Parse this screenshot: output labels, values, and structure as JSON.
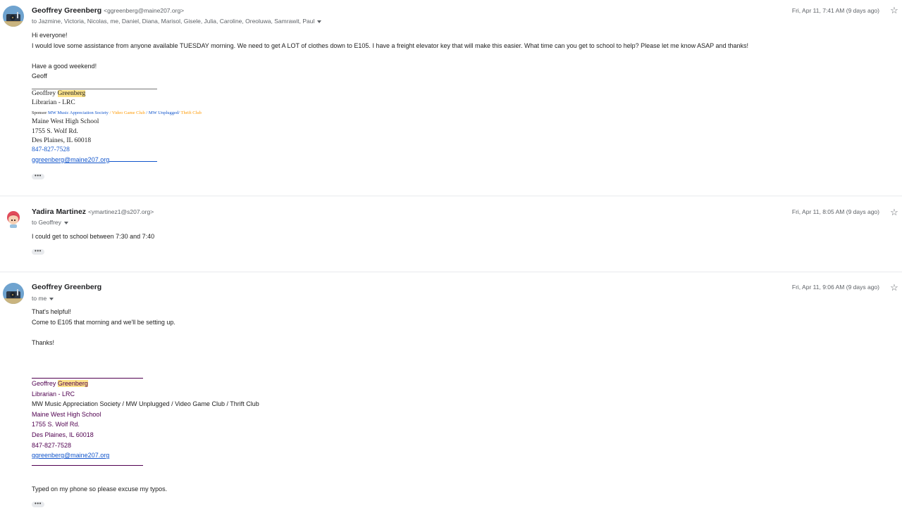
{
  "messages": [
    {
      "sender_name": "Geoffrey Greenberg",
      "sender_email": "<ggreenberg@maine207.org>",
      "recipients": "to Jazmine, Victoria, Nicolas, me, Daniel, Diana, Marisol, Gisele, Julia, Caroline, Oreoluwa, Samrawit, Paul",
      "date": "Fri, Apr 11, 7:41 AM (9 days ago)",
      "body_lines": [
        "Hi everyone!",
        "I would love some assistance from anyone available TUESDAY morning. We need to get A LOT of clothes down to E105. I have a freight elevator key that will make this easier. What time can you get to school to help? Please let me know ASAP and thanks!",
        "",
        "Have a good weekend!",
        "Geoff"
      ],
      "signature": {
        "name_first": "Geoffrey",
        "name_last": "Greenberg",
        "title": "Librarian - LRC",
        "sponsor_label": "Sponsor",
        "club1": "MW Music Appreciation Society",
        "sep1": " / ",
        "club2": "Video Game Club",
        "sep2": " / ",
        "club3": "MW Unplugged",
        "sep3": "/ ",
        "club4": "Thrift Club",
        "school": "Maine West High School",
        "address1": "1755 S. Wolf Rd.",
        "address2": "Des Plaines, IL 60018",
        "phone": "847-827-7528",
        "email": "ggreenberg@maine207.org"
      },
      "more_label": "•••"
    },
    {
      "sender_name": "Yadira Martinez",
      "sender_email": "<ymartinez1@s207.org>",
      "recipients": "to Geoffrey",
      "date": "Fri, Apr 11, 8:05 AM (9 days ago)",
      "body_lines": [
        "I could get to school between 7:30 and 7:40"
      ],
      "more_label": "•••"
    },
    {
      "sender_name": "Geoffrey Greenberg",
      "recipients": "to me",
      "date": "Fri, Apr 11, 9:06 AM (9 days ago)",
      "body_lines": [
        "That's helpful!",
        "Come to E105 that morning and we'll be setting up.",
        "",
        "Thanks!"
      ],
      "signature": {
        "name_first": "Geoffrey",
        "name_last": "Greenberg",
        "title": "Librarian - LRC",
        "clubs": "MW Music Appreciation Society / MW Unplugged / Video Game Club / Thrift Club",
        "school": "Maine West High School",
        "address1": "1755 S. Wolf Rd.",
        "address2": "Des Plaines, IL 60018",
        "phone": "847-827-7528",
        "email": "ggreenberg@maine207.org"
      },
      "footer": "Typed on my phone so please excuse my typos.",
      "more_label": "•••"
    }
  ],
  "icons": {
    "star": "star-outline-icon",
    "caret": "chevron-down-icon",
    "more": "more-horiz-icon"
  }
}
